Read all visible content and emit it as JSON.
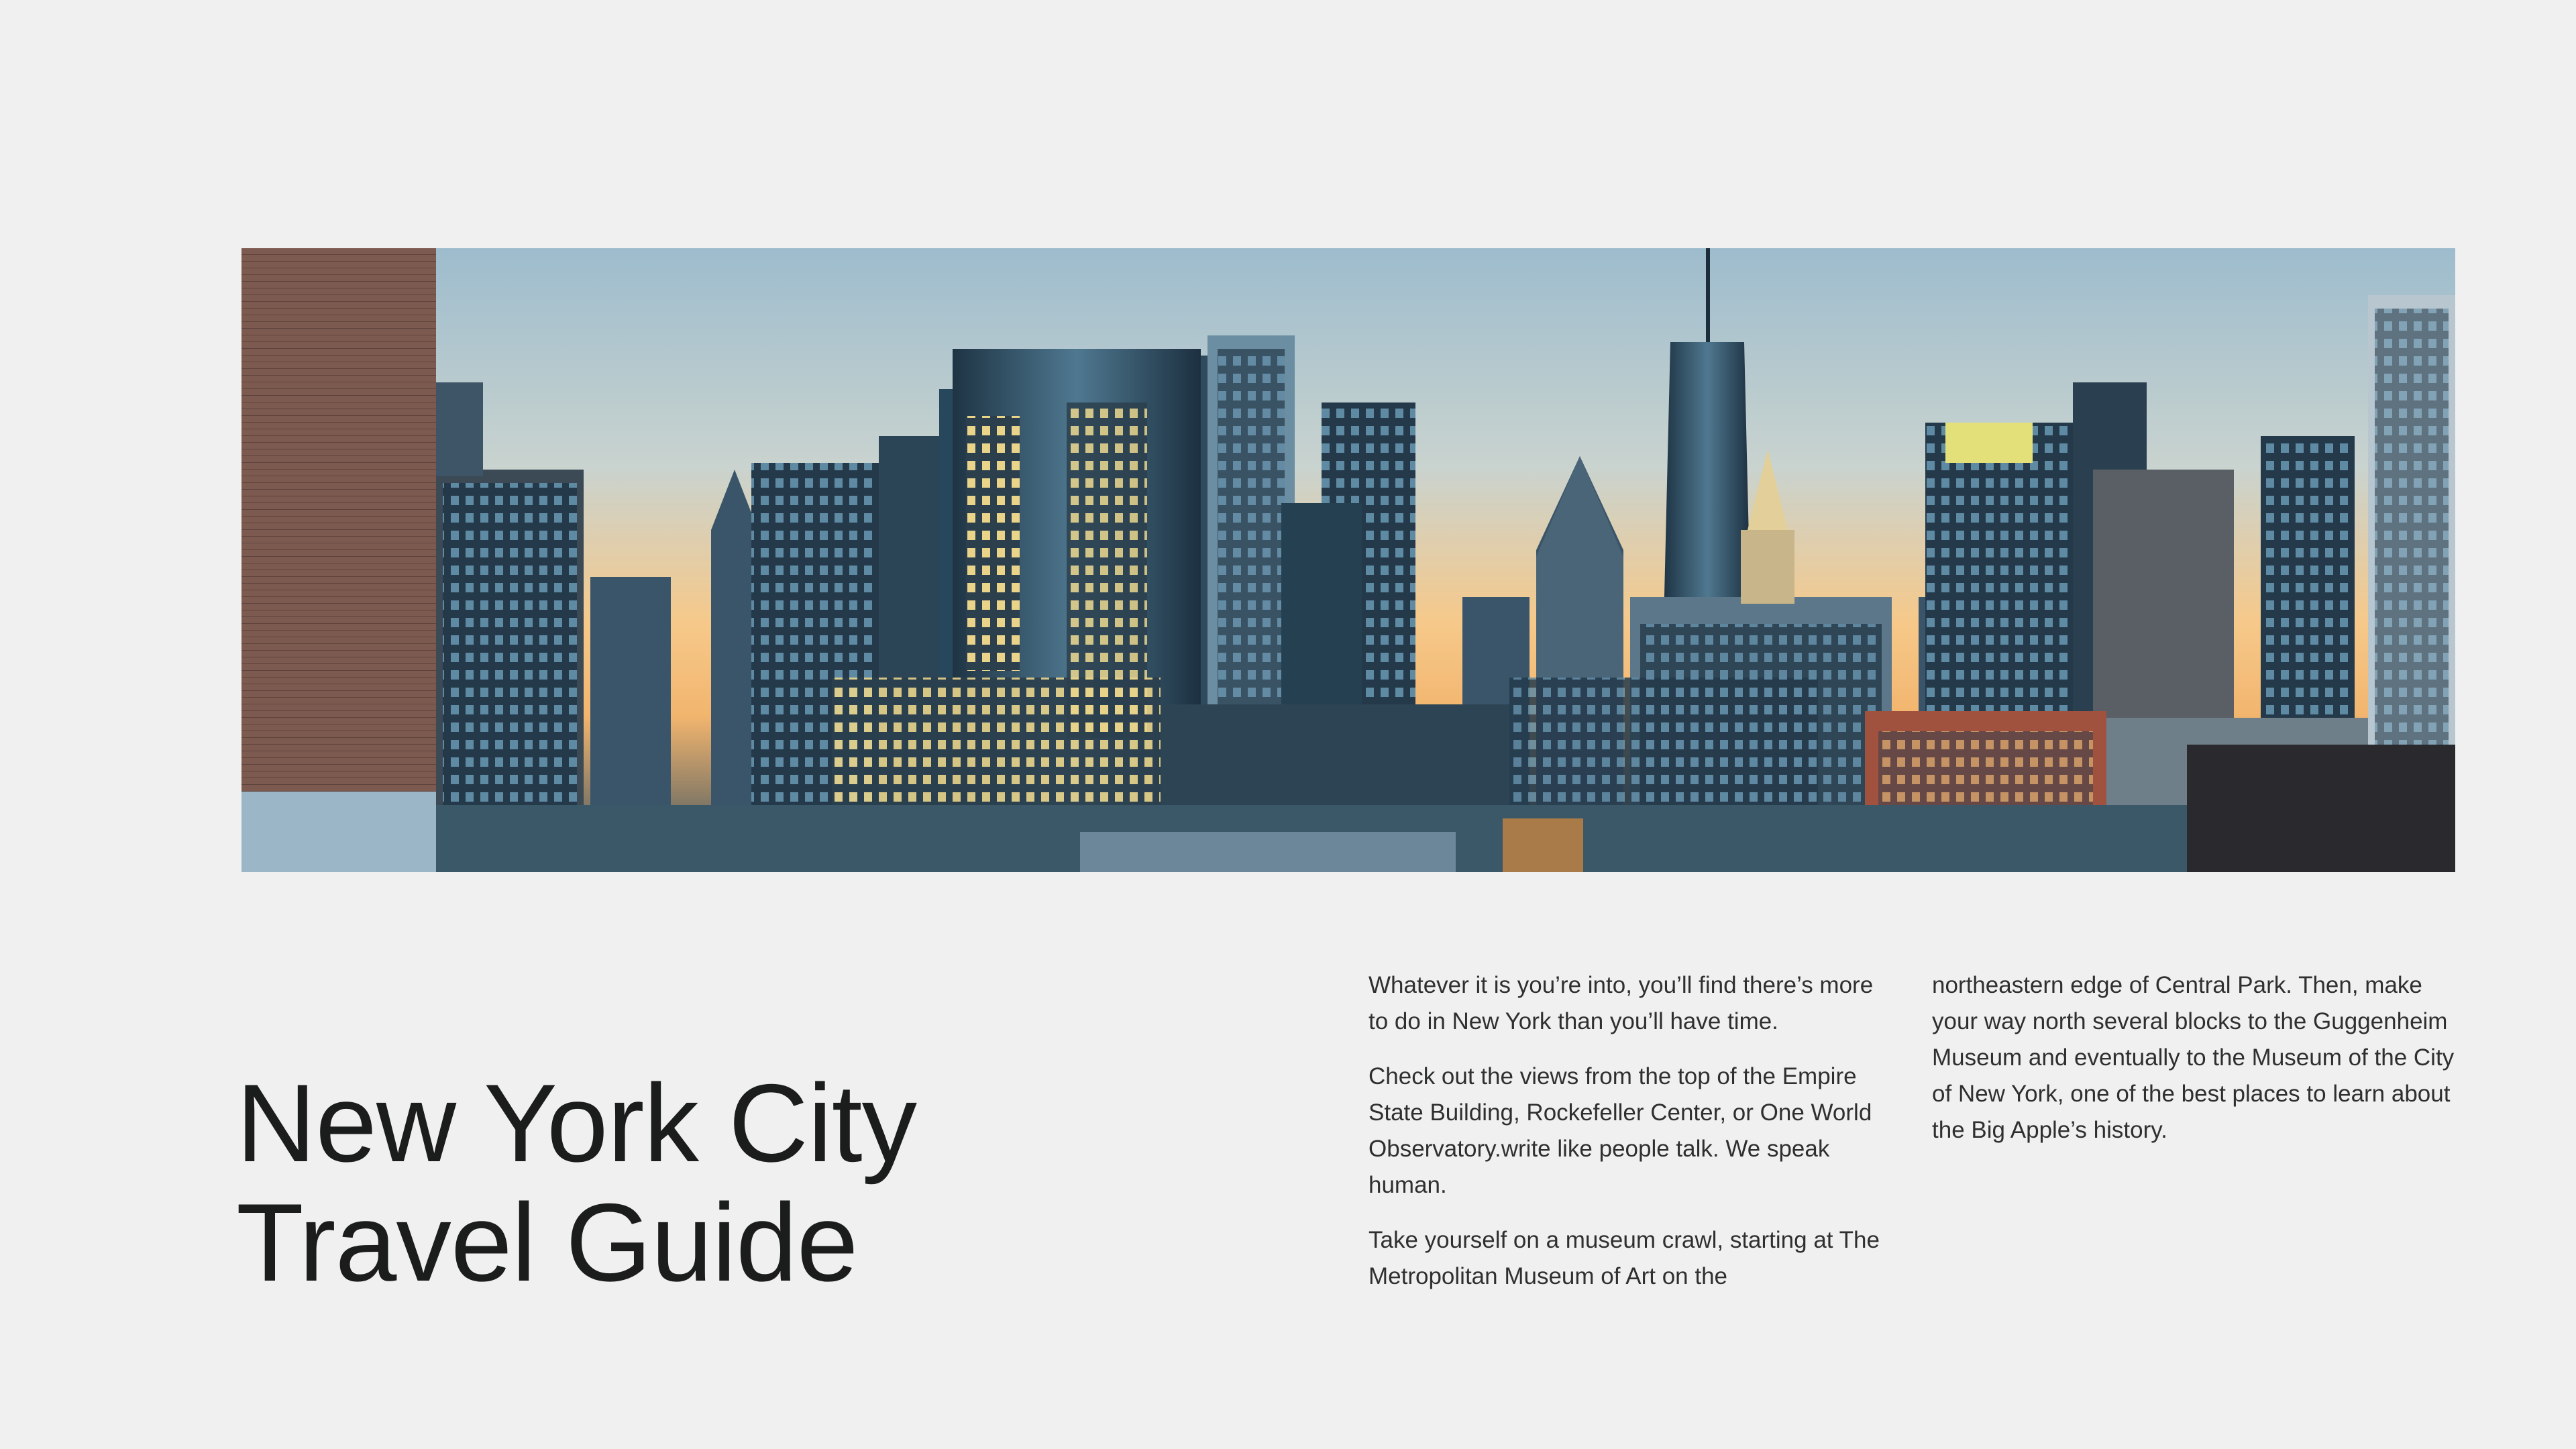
{
  "hero": {
    "image": "new-york-city-skyline-photo",
    "colors": {
      "sky_top": "#8fb2c6",
      "sky_glow": "#f6c98a",
      "buildings_dark": "#22394a",
      "buildings_mid": "#3d5d73",
      "window_light": "#ffe49a",
      "brick": "#8a5a4a"
    }
  },
  "title": {
    "line1": "New York City",
    "line2": "Travel Guide"
  },
  "body": {
    "left_paragraphs": [
      "Whatever it is you’re into, you’ll find there’s more to do in New York than you’ll have time.",
      "Check out the views from the top of the Empire State Building, Rockefeller Center, or One World Observatory.write like people talk. We speak human.",
      "Take yourself on a museum crawl, starting at The Metropolitan Museum of Art on the"
    ],
    "right_paragraphs": [
      "northeastern edge of Central Park. Then, make your way north several blocks to the Guggenheim Museum and eventually to the Museum of the City of New York, one of the best places to learn about the Big Apple’s history."
    ]
  }
}
